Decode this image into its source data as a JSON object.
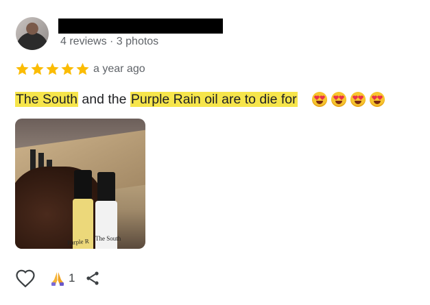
{
  "reviewer": {
    "meta": "4 reviews · 3 photos"
  },
  "review": {
    "rating": 5,
    "time": "a year ago",
    "text_parts": [
      "The South",
      " and the ",
      "Purple Rain oil are to die for"
    ],
    "emojis": [
      "smiling-face-with-heart-eyes-icon",
      "smiling-face-with-heart-eyes-icon",
      "smiling-face-with-heart-eyes-icon",
      "smiling-face-with-heart-eyes-icon"
    ]
  },
  "photo": {
    "bottle_label_left": "Purple R",
    "bottle_label_right": "The South"
  },
  "actions": {
    "reaction_count": "1"
  },
  "colors": {
    "star": "#fbbc04",
    "highlight": "#f6e54b"
  }
}
